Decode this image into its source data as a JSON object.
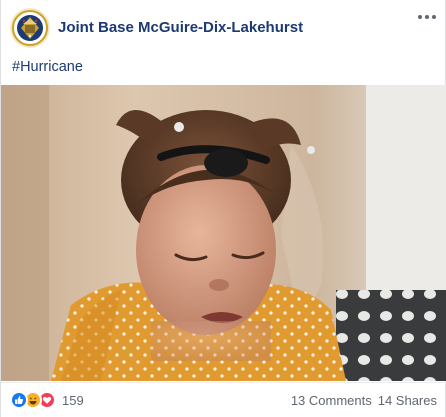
{
  "page": {
    "name": "Joint Base McGuire-Dix-Lakehurst",
    "avatar_icon": "base-seal-icon"
  },
  "post": {
    "text": "#Hurricane"
  },
  "footer": {
    "reaction_count": "159",
    "reaction_icons": [
      "like-icon",
      "haha-icon",
      "love-icon"
    ],
    "comments": "13 Comments",
    "shares": "14 Shares"
  },
  "colors": {
    "link": "#1d3a74",
    "like": "#1877f2",
    "haha": "#f7b125",
    "love": "#f33e58",
    "muted": "#606770"
  }
}
